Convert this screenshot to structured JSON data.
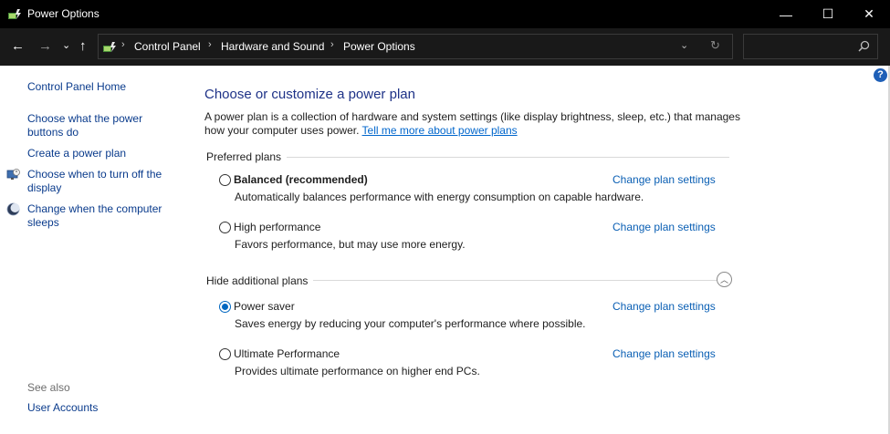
{
  "window": {
    "title": "Power Options",
    "controls": {
      "minimize": "—",
      "maximize": "☐",
      "close": "✕"
    }
  },
  "nav": {
    "back": "←",
    "forward": "→",
    "recent": "⌄",
    "up": "↑"
  },
  "address": {
    "breadcrumbs": [
      "Control Panel",
      "Hardware and Sound",
      "Power Options"
    ],
    "separator": "›",
    "dropdown": "⌄",
    "refresh": "↻",
    "search_placeholder": ""
  },
  "sidebar": {
    "home": "Control Panel Home",
    "links": [
      {
        "label": "Choose what the power buttons do",
        "icon": ""
      },
      {
        "label": "Create a power plan",
        "icon": ""
      },
      {
        "label": "Choose when to turn off the display",
        "icon": "monitor-clock-icon"
      },
      {
        "label": "Change when the computer sleeps",
        "icon": "moon-icon"
      }
    ],
    "see_also_label": "See also",
    "see_also_links": [
      "User Accounts"
    ]
  },
  "main": {
    "heading": "Choose or customize a power plan",
    "description": "A power plan is a collection of hardware and system settings (like display brightness, sleep, etc.) that manages how your computer uses power.",
    "learn_more_link": "Tell me more about power plans",
    "preferred_label": "Preferred plans",
    "additional_label": "Hide additional plans",
    "change_link_label": "Change plan settings",
    "plans": [
      {
        "name": "Balanced (recommended)",
        "description": "Automatically balances performance with energy consumption on capable hardware.",
        "selected": false
      },
      {
        "name": "High performance",
        "description": "Favors performance, but may use more energy.",
        "selected": false
      },
      {
        "name": "Power saver",
        "description": "Saves energy by reducing your computer's performance where possible.",
        "selected": true
      },
      {
        "name": "Ultimate Performance",
        "description": "Provides ultimate performance on higher end PCs.",
        "selected": false
      }
    ]
  },
  "colors": {
    "titlebar": "#000000",
    "addressbar": "#191919",
    "link": "#0a5fb4",
    "heading": "#1e3287",
    "radio_selected": "#0067c0"
  }
}
